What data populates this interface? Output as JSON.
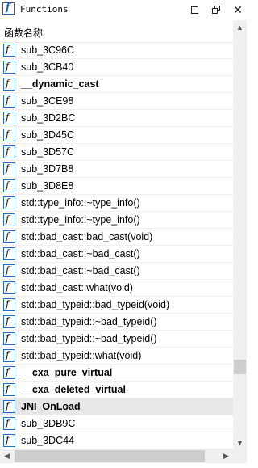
{
  "window": {
    "title": "Functions",
    "app_icon": "function-icon",
    "buttons": [
      "maximize",
      "restore",
      "close"
    ],
    "close_glyph": "✕"
  },
  "header": {
    "column_label": "函数名称"
  },
  "functions": [
    {
      "name": "sub_3C96C",
      "bold": false
    },
    {
      "name": "sub_3CB40",
      "bold": false
    },
    {
      "name": "__dynamic_cast",
      "bold": true
    },
    {
      "name": "sub_3CE98",
      "bold": false
    },
    {
      "name": "sub_3D2BC",
      "bold": false
    },
    {
      "name": "sub_3D45C",
      "bold": false
    },
    {
      "name": "sub_3D57C",
      "bold": false
    },
    {
      "name": "sub_3D7B8",
      "bold": false
    },
    {
      "name": "sub_3D8E8",
      "bold": false
    },
    {
      "name": "std::type_info::~type_info()",
      "bold": false
    },
    {
      "name": "std::type_info::~type_info()",
      "bold": false
    },
    {
      "name": "std::bad_cast::bad_cast(void)",
      "bold": false
    },
    {
      "name": "std::bad_cast::~bad_cast()",
      "bold": false
    },
    {
      "name": "std::bad_cast::~bad_cast()",
      "bold": false
    },
    {
      "name": "std::bad_cast::what(void)",
      "bold": false
    },
    {
      "name": "std::bad_typeid::bad_typeid(void)",
      "bold": false
    },
    {
      "name": "std::bad_typeid::~bad_typeid()",
      "bold": false
    },
    {
      "name": "std::bad_typeid::~bad_typeid()",
      "bold": false
    },
    {
      "name": "std::bad_typeid::what(void)",
      "bold": false
    },
    {
      "name": "__cxa_pure_virtual",
      "bold": true
    },
    {
      "name": "__cxa_deleted_virtual",
      "bold": true
    },
    {
      "name": "JNI_OnLoad",
      "bold": true,
      "selected": true
    },
    {
      "name": "sub_3DB9C",
      "bold": false
    },
    {
      "name": "sub_3DC44",
      "bold": false
    }
  ],
  "scrollbars": {
    "up_glyph": "▲",
    "down_glyph": "▼",
    "left_glyph": "◀",
    "right_glyph": "▶",
    "vertical_position_fraction": 0.82
  },
  "colors": {
    "icon_border": "#1f6fd0",
    "selected_row": "#e8e8e8"
  }
}
